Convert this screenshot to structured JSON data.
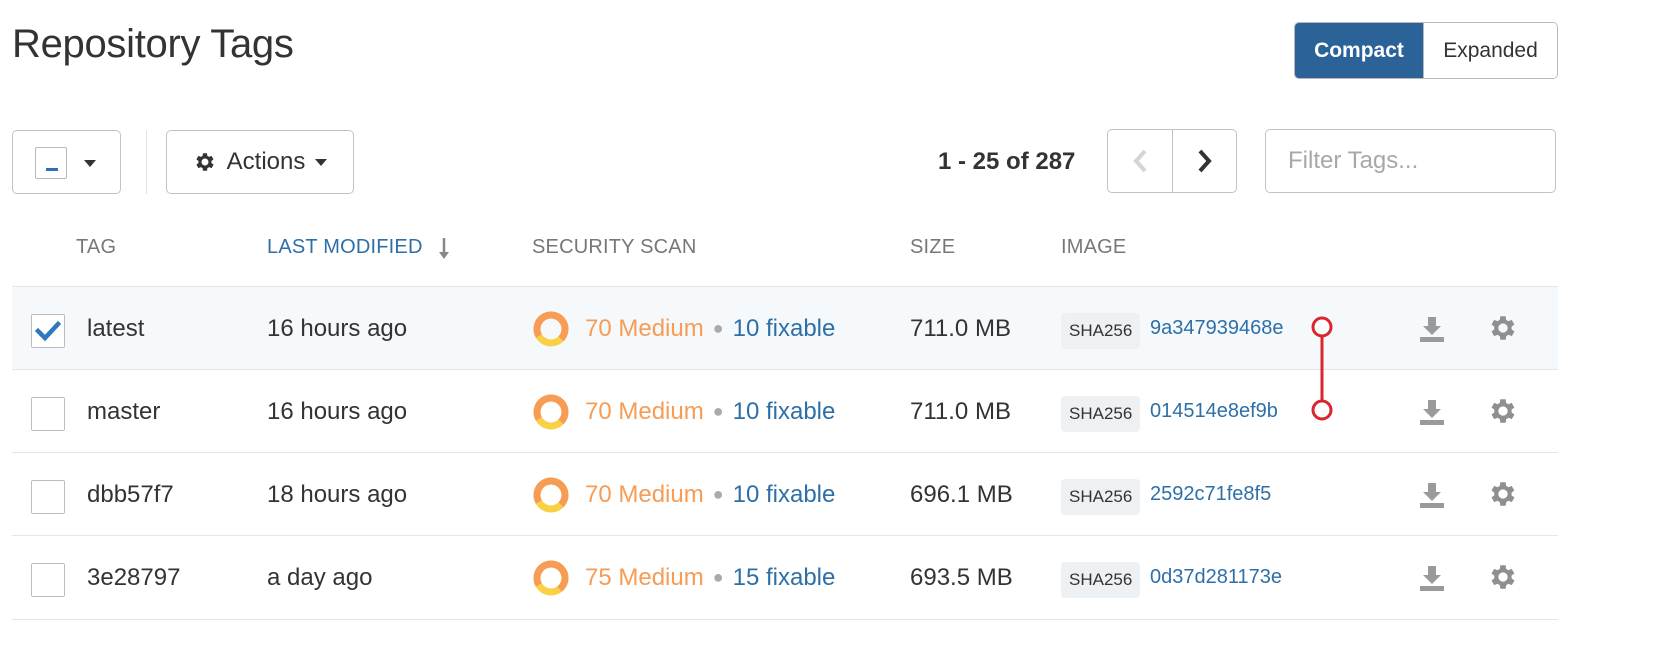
{
  "header": {
    "title": "Repository Tags",
    "view_modes": {
      "compact": "Compact",
      "expanded": "Expanded",
      "active": "compact"
    }
  },
  "toolbar": {
    "actions_label": "Actions",
    "pagination_text": "1 - 25 of 287",
    "filter_placeholder": "Filter Tags..."
  },
  "columns": {
    "tag": "TAG",
    "last_modified": "LAST MODIFIED",
    "security_scan": "SECURITY SCAN",
    "size": "SIZE",
    "image": "IMAGE"
  },
  "rows": [
    {
      "selected": true,
      "tag": "latest",
      "modified": "16 hours ago",
      "severity": "70 Medium",
      "fixable": "10 fixable",
      "size": "711.0 MB",
      "digest_type": "SHA256",
      "digest": "9a347939468e"
    },
    {
      "selected": false,
      "tag": "master",
      "modified": "16 hours ago",
      "severity": "70 Medium",
      "fixable": "10 fixable",
      "size": "711.0 MB",
      "digest_type": "SHA256",
      "digest": "014514e8ef9b"
    },
    {
      "selected": false,
      "tag": "dbb57f7",
      "modified": "18 hours ago",
      "severity": "70 Medium",
      "fixable": "10 fixable",
      "size": "696.1 MB",
      "digest_type": "SHA256",
      "digest": "2592c71fe8f5"
    },
    {
      "selected": false,
      "tag": "3e28797",
      "modified": "a day ago",
      "severity": "75 Medium",
      "fixable": "15 fixable",
      "size": "693.5 MB",
      "digest_type": "SHA256",
      "digest": "0d37d281173e"
    }
  ],
  "icons": {
    "sort": "arrow-down-icon",
    "actions": "gear-icon",
    "row_download": "download-icon",
    "row_options": "gear-icon",
    "scan": "donut-chart-icon",
    "link": "same-image-connector-icon"
  },
  "colors": {
    "accent": "#2b6399",
    "link": "#2e6fa8",
    "medium_severity": "#f69c55",
    "low_severity": "#f8d147",
    "connector": "#d9262f",
    "selected_row": "#f5f9fc"
  }
}
